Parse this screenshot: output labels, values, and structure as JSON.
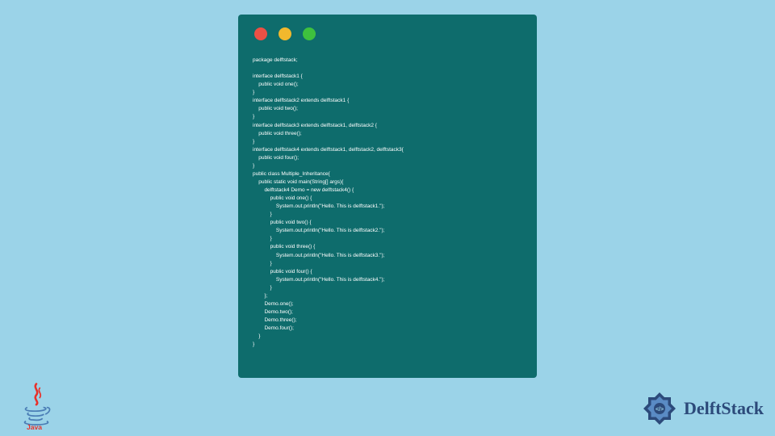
{
  "code": "package delftstack;\n\ninterface delftstack1 {\n    public void one();\n}\ninterface delftstack2 extends delftstack1 {\n    public void two();\n}\ninterface delftstack3 extends delftstack1, delftstack2 {\n    public void three();\n}\ninterface delftstack4 extends delftstack1, delftstack2, delftstack3{\n    public void four();\n}\npublic class Multiple_Inheritance{\n    public static void main(String[] args){\n        delftstack4 Demo = new delftstack4() {\n            public void one() {\n                System.out.println(\"Hello. This is delftstack1.\");\n            }\n            public void two() {\n                System.out.println(\"Hello. This is delftstack2.\");\n            }\n            public void three() {\n                System.out.println(\"Hello. This is delftstack3.\");\n            }\n            public void four() {\n                System.out.println(\"Hello. This is delftstack4.\");\n            }\n        };\n        Demo.one();\n        Demo.two();\n        Demo.three();\n        Demo.four();\n    }\n}",
  "brand": "DelftStack"
}
